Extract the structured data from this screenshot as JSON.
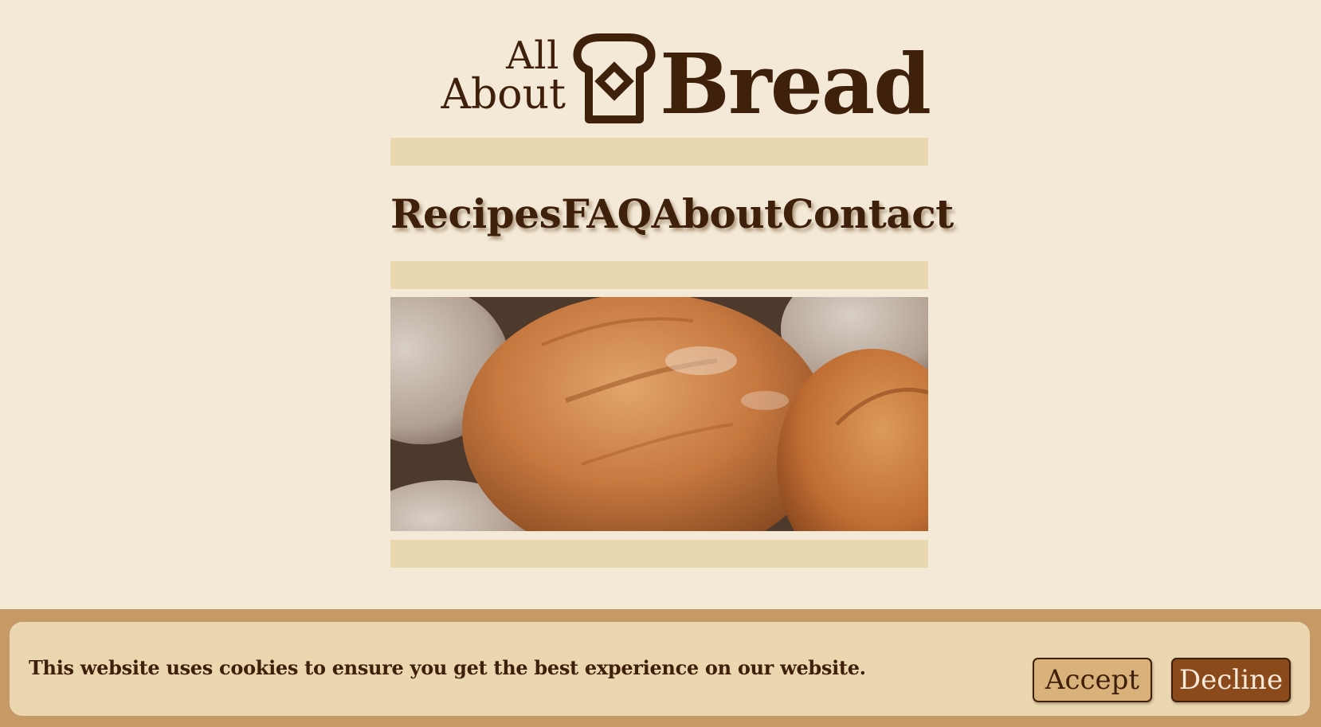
{
  "logo": {
    "line1": "All",
    "line2": "About",
    "brand": "Bread",
    "icon": "bread-slice-icon"
  },
  "nav": {
    "items": [
      {
        "label": "Recipes"
      },
      {
        "label": "FAQ"
      },
      {
        "label": "About"
      },
      {
        "label": "Contact"
      }
    ]
  },
  "hero": {
    "alt": "Crusty loaves of bread"
  },
  "cookie_banner": {
    "message": "This website uses cookies to ensure you get the best experience on our website.",
    "accept_label": "Accept",
    "decline_label": "Decline"
  },
  "colors": {
    "page_background": "#f3e9d6",
    "accent_bar": "#e9d7b0",
    "text_dark_brown": "#3f200b",
    "banner_band": "#c69a67",
    "banner_card": "#ead7b0",
    "accept_button": "#d9b17a",
    "decline_button": "#8a4a1b"
  }
}
